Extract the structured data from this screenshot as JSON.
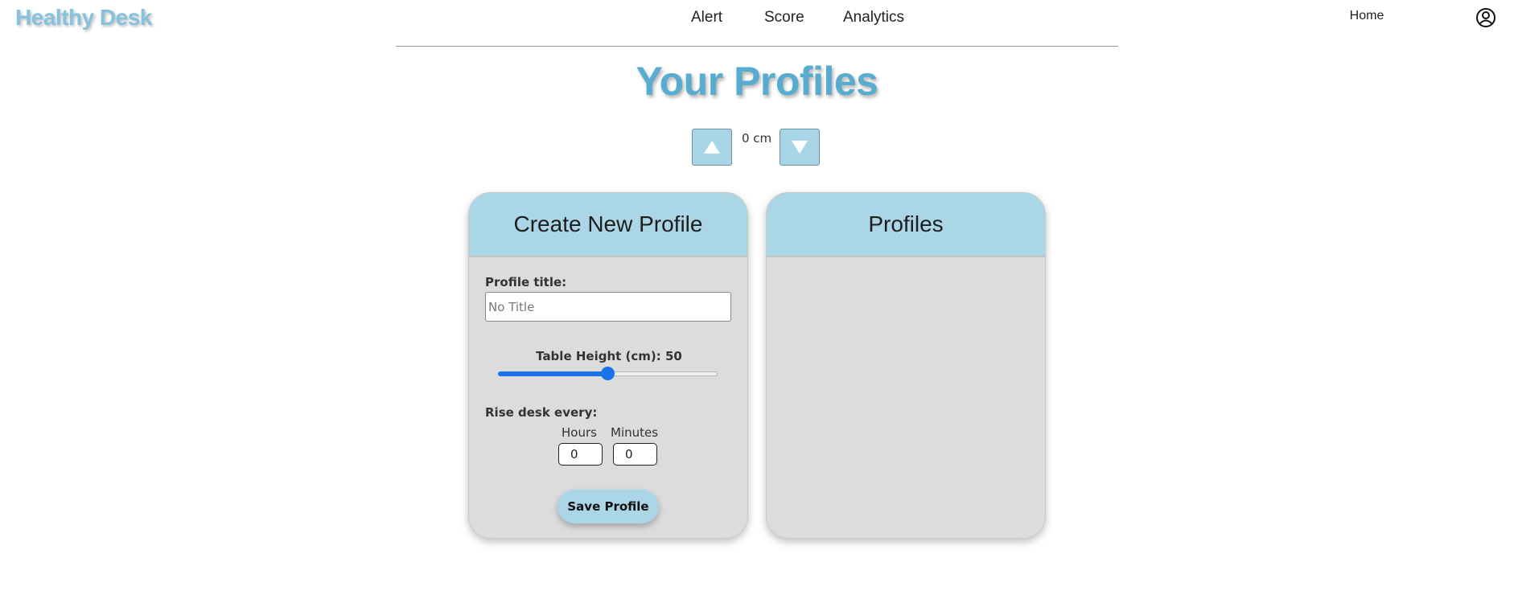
{
  "header": {
    "brand": "Healthy Desk",
    "nav": [
      {
        "label": "Home"
      },
      {
        "label": "Alert"
      },
      {
        "label": "Score"
      },
      {
        "label": "Analytics"
      }
    ],
    "account_icon": "account-circle-icon"
  },
  "page": {
    "title": "Your Profiles"
  },
  "desk_control": {
    "up_icon": "triangle-up-icon",
    "down_icon": "triangle-down-icon",
    "height_readout": "0 cm"
  },
  "create_card": {
    "title": "Create New Profile",
    "profile_title_label": "Profile title:",
    "profile_title_value": "",
    "profile_title_placeholder": "No Title",
    "height_label": "Table Height (cm): 50",
    "height_slider": {
      "value": 50,
      "fraction": 0.5
    },
    "rise_label": "Rise desk every:",
    "hours_label": "Hours",
    "hours_value": "0",
    "minutes_label": "Minutes",
    "minutes_value": "0",
    "save_label": "Save Profile"
  },
  "profiles_card": {
    "title": "Profiles"
  },
  "colors": {
    "brand": "#86c1dd",
    "title": "#58acd0",
    "card_header": "#abd6e6",
    "card_body": "#dcdcdc",
    "slider_accent": "#1a73e8"
  }
}
